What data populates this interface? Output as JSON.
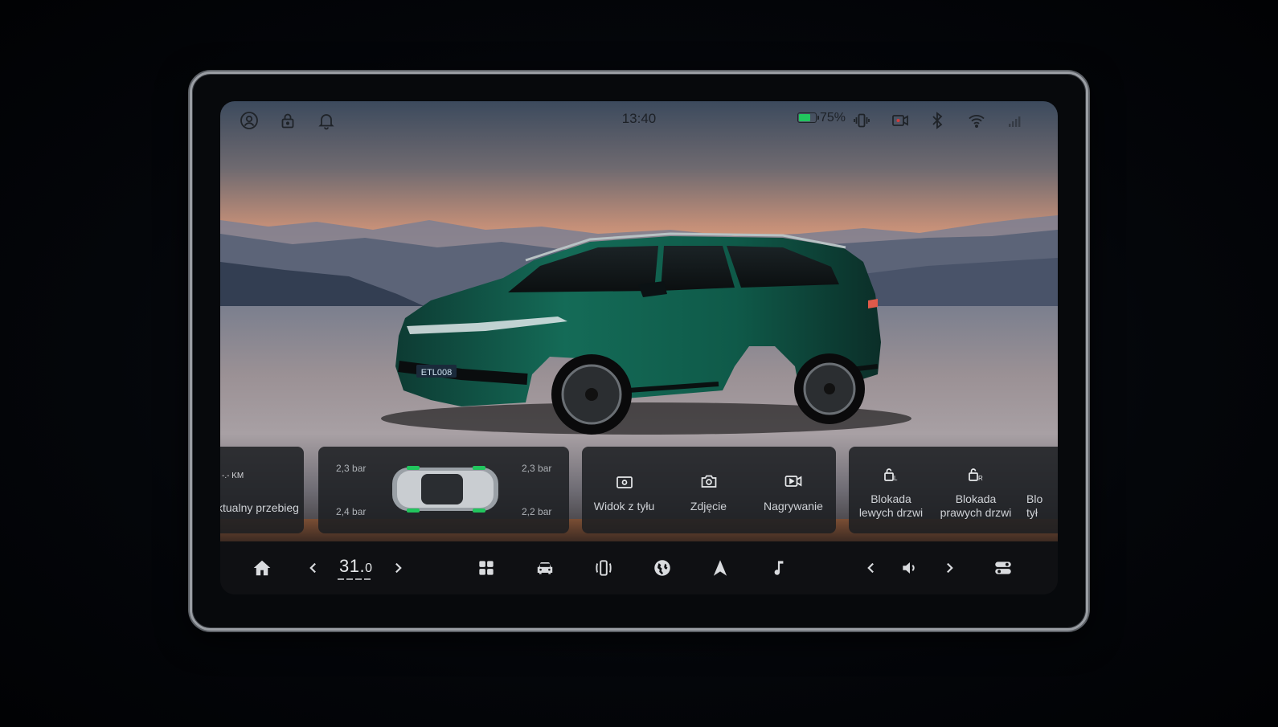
{
  "status_bar": {
    "time": "13:40",
    "battery_percent": "75%",
    "battery_level": 0.75,
    "battery_color": "#22c55e",
    "left_icons": [
      "user-icon",
      "lock-icon",
      "bell-icon"
    ],
    "right_icons": [
      "vibrate-icon",
      "dashcam-icon",
      "bluetooth-icon",
      "wifi-icon",
      "signal-icon"
    ]
  },
  "scene": {
    "plate": "ETL008"
  },
  "cards": {
    "mileage": {
      "value": "-.- KM",
      "label": "ktualny przebieg"
    },
    "tires": {
      "front_left": "2,3 bar",
      "front_right": "2,3 bar",
      "rear_left": "2,4 bar",
      "rear_right": "2,2 bar",
      "ok_color": "#22c55e"
    },
    "camera": [
      {
        "label": "Widok z tyłu",
        "icon": "rear-view-icon"
      },
      {
        "label": "Zdjęcie",
        "icon": "camera-icon"
      },
      {
        "label": "Nagrywanie",
        "icon": "record-icon"
      }
    ],
    "locks": [
      {
        "label": "Blokada\nlewych drzwi",
        "icon": "lock-left-door-icon"
      },
      {
        "label": "Blokada\nprawych drzwi",
        "icon": "lock-right-door-icon"
      },
      {
        "label": "Blo\ntył",
        "icon": "lock-rear-icon"
      }
    ]
  },
  "dock": {
    "temperature_whole": "31.",
    "temperature_decimal": "0",
    "icons": [
      "home-icon",
      "chevron-left-icon",
      "chevron-right-icon",
      "apps-icon",
      "car-icon",
      "phone-projection-icon",
      "globe-icon",
      "navigation-icon",
      "music-icon",
      "volume-icon",
      "settings-toggle-icon"
    ]
  }
}
